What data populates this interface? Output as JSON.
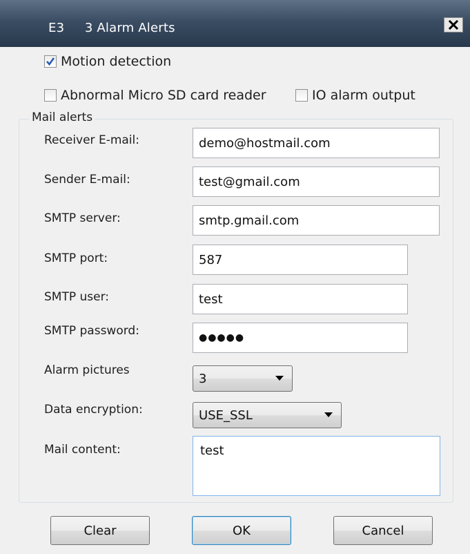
{
  "window": {
    "title": "E3     3 Alarm Alerts"
  },
  "checkboxes": {
    "motion_detection": {
      "label": "Motion detection",
      "checked": true
    },
    "abnormal_sd": {
      "label": "Abnormal Micro SD card reader",
      "checked": false
    },
    "io_alarm": {
      "label": "IO alarm output",
      "checked": false
    }
  },
  "mail": {
    "group_label": "Mail alerts",
    "receiver_label": "Receiver E-mail:",
    "receiver_value": "demo@hostmail.com",
    "sender_label": "Sender E-mail:",
    "sender_value": "test@gmail.com",
    "smtp_server_label": "SMTP server:",
    "smtp_server_value": "smtp.gmail.com",
    "smtp_port_label": "SMTP port:",
    "smtp_port_value": "587",
    "smtp_user_label": "SMTP user:",
    "smtp_user_value": "test",
    "smtp_password_label": "SMTP password:",
    "smtp_password_value": "●●●●●",
    "alarm_pictures_label": "Alarm pictures",
    "alarm_pictures_value": "3",
    "encryption_label": "Data encryption:",
    "encryption_value": "USE_SSL",
    "content_label": "Mail content:",
    "content_value": "test"
  },
  "buttons": {
    "clear": "Clear",
    "ok": "OK",
    "cancel": "Cancel"
  },
  "icons": {
    "close": "close-icon",
    "check": "checkmark-icon",
    "dropdown": "chevron-down-icon"
  },
  "colors": {
    "titlebar": "#3b4d63",
    "check": "#2a5db5",
    "focus_border": "#7eb4ea"
  }
}
